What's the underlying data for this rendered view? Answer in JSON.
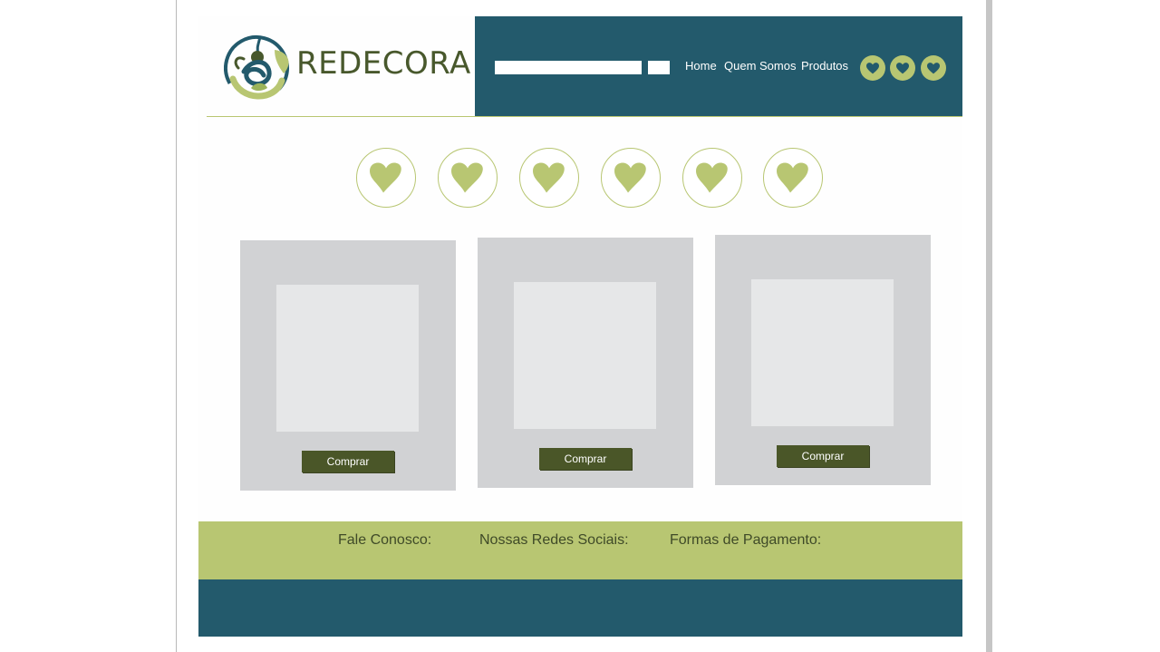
{
  "brand": {
    "name": "REDECORA",
    "colors": {
      "primary": "#235a6c",
      "accent": "#b8c672",
      "dark": "#4a5628"
    }
  },
  "header": {
    "search": {
      "value": "",
      "placeholder": ""
    },
    "nav": [
      "Home",
      "Quem Somos",
      "Produtos"
    ],
    "social_icons": [
      "heart-icon",
      "heart-icon",
      "heart-icon"
    ]
  },
  "categories": [
    "heart-icon",
    "heart-icon",
    "heart-icon",
    "heart-icon",
    "heart-icon",
    "heart-icon"
  ],
  "products": [
    {
      "button": "Comprar"
    },
    {
      "button": "Comprar"
    },
    {
      "button": "Comprar"
    }
  ],
  "footer": {
    "contact": "Fale Conosco:",
    "social": "Nossas Redes Sociais:",
    "payment": "Formas de Pagamento:"
  }
}
